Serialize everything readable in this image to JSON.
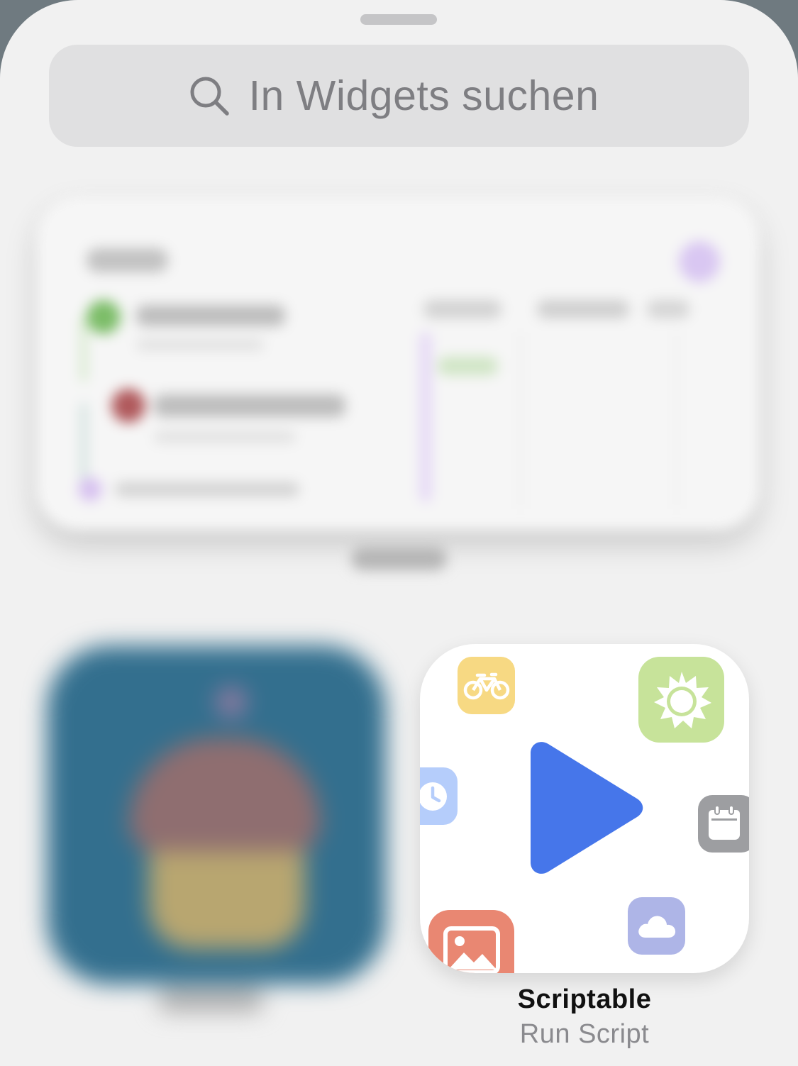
{
  "search": {
    "placeholder": "In Widgets suchen"
  },
  "scriptable_widget": {
    "title": "Scriptable",
    "subtitle": "Run Script",
    "colors": {
      "play": "#4676ea",
      "bike_tile": "#f7d983",
      "sun_tile": "#c7e39a",
      "clock_tile": "#b5cdfb",
      "calendar_tile": "#9d9ea1",
      "cloud_tile": "#aeb5e7",
      "photo_tile": "#e98772"
    },
    "icons": [
      "bicycle-icon",
      "sun-icon",
      "clock-icon",
      "calendar-icon",
      "cloud-icon",
      "photo-icon",
      "play-icon"
    ]
  }
}
